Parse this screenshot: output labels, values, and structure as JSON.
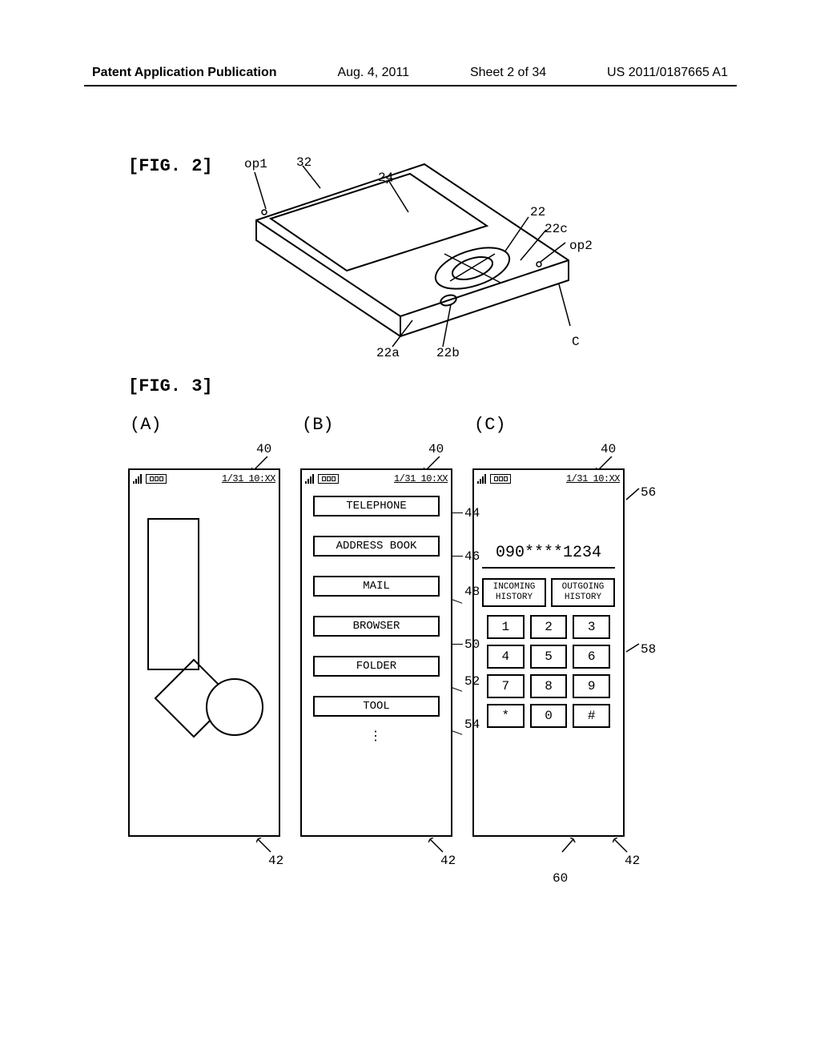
{
  "header": {
    "left": "Patent Application Publication",
    "date": "Aug. 4, 2011",
    "sheet": "Sheet 2 of 34",
    "pubno": "US 2011/0187665 A1"
  },
  "fig2": {
    "label": "[FIG. 2]",
    "refs": {
      "op1": "op1",
      "r32": "32",
      "r24": "24",
      "r22": "22",
      "r22c": "22c",
      "op2": "op2",
      "r22a": "22a",
      "r22b": "22b",
      "rC": "C"
    }
  },
  "fig3": {
    "label": "[FIG. 3]",
    "panels": {
      "a": "(A)",
      "b": "(B)",
      "c": "(C)"
    },
    "status": {
      "datetime": "1/31  10:XX"
    },
    "refs": {
      "r40a": "40",
      "r40b": "40",
      "r40c": "40",
      "r42a": "42",
      "r42b": "42",
      "r42c": "42",
      "r44": "44",
      "r46": "46",
      "r48": "48",
      "r50": "50",
      "r52": "52",
      "r54": "54",
      "r56": "56",
      "r58": "58",
      "r60": "60"
    },
    "menu": {
      "telephone": "TELEPHONE",
      "address_book": "ADDRESS BOOK",
      "mail": "MAIL",
      "browser": "BROWSER",
      "folder": "FOLDER",
      "tool": "TOOL",
      "more": "⋮"
    },
    "dialer": {
      "number": "090****1234",
      "incoming_l1": "INCOMING",
      "incoming_l2": "HISTORY",
      "outgoing_l1": "OUTGOING",
      "outgoing_l2": "HISTORY",
      "keys": [
        "1",
        "2",
        "3",
        "4",
        "5",
        "6",
        "7",
        "8",
        "9",
        "*",
        "0",
        "#"
      ]
    }
  }
}
